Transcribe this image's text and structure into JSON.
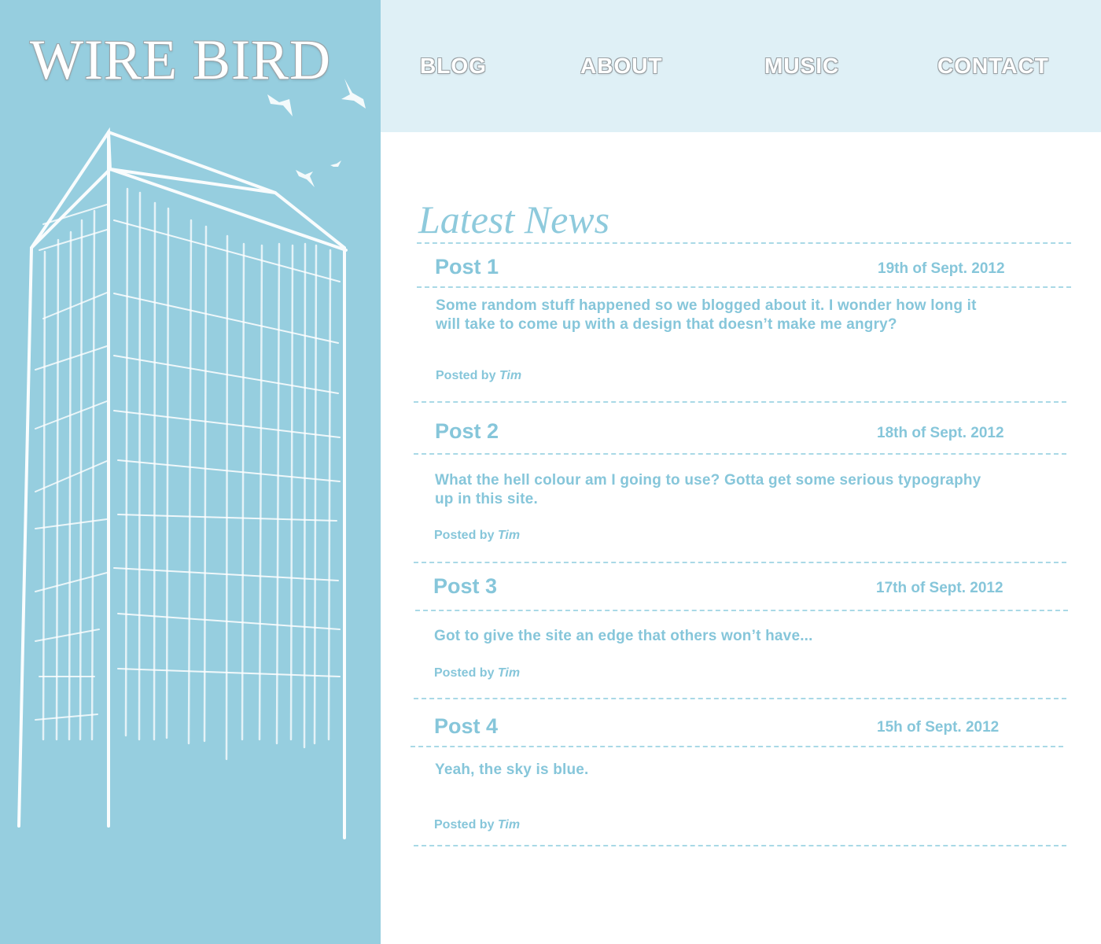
{
  "site": {
    "title": "WIRE BIRD"
  },
  "nav": {
    "items": [
      "BLOG",
      "ABOUT",
      "MUSIC",
      "CONTACT"
    ]
  },
  "main": {
    "section_title": "Latest News",
    "posts": [
      {
        "title": "Post 1",
        "date": "19th of Sept. 2012",
        "body": "Some random stuff happened so we blogged about it. I wonder how long it will take to come up with a design that doesn’t make me angry?",
        "posted_by_label": "Posted by",
        "author": "Tim"
      },
      {
        "title": "Post 2",
        "date": "18th of Sept. 2012",
        "body": "What the hell colour am I going to use? Gotta get some serious typography up in this site.",
        "posted_by_label": "Posted by",
        "author": "Tim"
      },
      {
        "title": "Post 3",
        "date": "17th of Sept. 2012",
        "body": "Got to give the site an edge that others won’t have...",
        "posted_by_label": "Posted by",
        "author": "Tim"
      },
      {
        "title": "Post 4",
        "date": "15h of Sept. 2012",
        "body": "Yeah, the sky is blue.",
        "posted_by_label": "Posted by",
        "author": "Tim"
      }
    ]
  },
  "colors": {
    "sidebar": "#96cedf",
    "topbar": "#dff0f6",
    "text": "#86c6da",
    "rule": "#a9d9e6"
  },
  "icons": {
    "birds": "bird-icon",
    "building": "building-illustration"
  }
}
